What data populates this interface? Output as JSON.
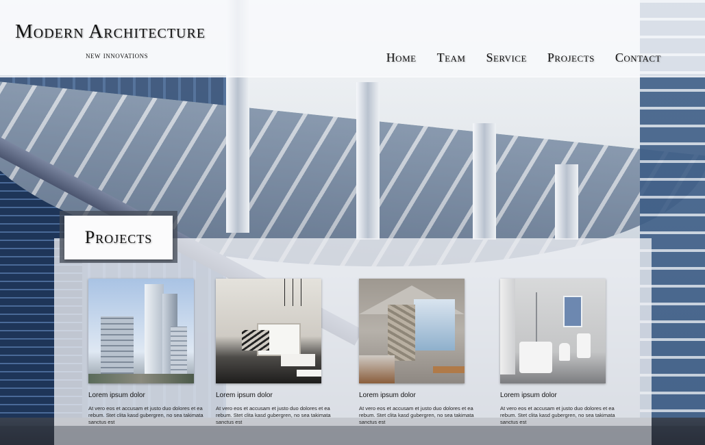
{
  "site": {
    "title": "Modern Architecture",
    "subtitle": "new innovations"
  },
  "nav": {
    "items": [
      {
        "label": "Home"
      },
      {
        "label": "Team"
      },
      {
        "label": "Service"
      },
      {
        "label": "Projects"
      },
      {
        "label": "Contact"
      }
    ]
  },
  "section": {
    "heading": "Projects"
  },
  "projects": [
    {
      "title": "Lorem ipsum dolor",
      "text": "At vero eos et accusam et justo duo dolores et ea rebum. Stet clita kasd gubergren, no sea takimata sanctus est",
      "image": "modern-towers-photo"
    },
    {
      "title": "Lorem ipsum dolor",
      "text": "At vero eos et accusam et justo duo dolores et ea rebum. Stet clita kasd gubergren, no sea takimata sanctus est",
      "image": "loft-living-room-photo"
    },
    {
      "title": "Lorem ipsum dolor",
      "text": "At vero eos et accusam et justo duo dolores et ea rebum. Stet clita kasd gubergren, no sea takimata sanctus est",
      "image": "stone-kitchen-interior-photo"
    },
    {
      "title": "Lorem ipsum dolor",
      "text": "At vero eos et accusam et justo duo dolores et ea rebum. Stet clita kasd gubergren, no sea takimata sanctus est",
      "image": "white-bathroom-photo"
    }
  ],
  "colors": {
    "text": "#111111",
    "header_bg": "#f8f9fb",
    "panel_bg": "#eef0f4",
    "heading_frame": "#464c58"
  }
}
